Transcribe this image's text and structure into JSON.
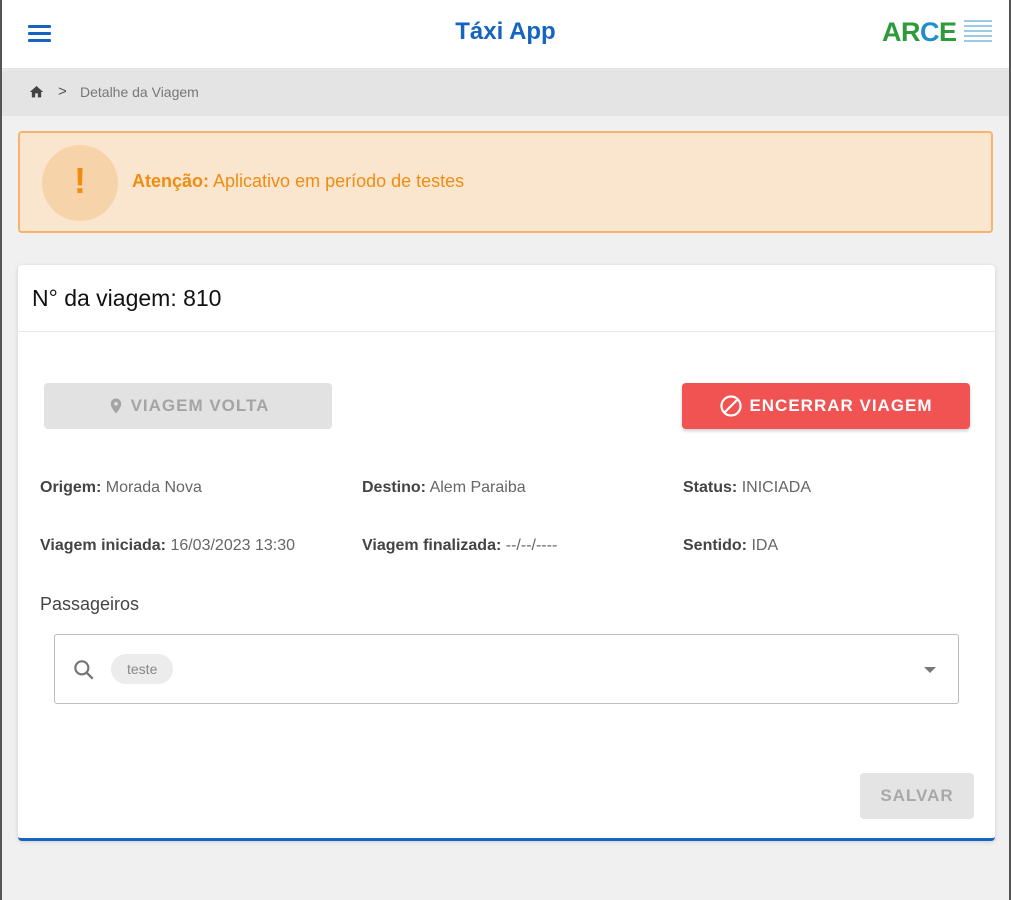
{
  "header": {
    "title": "Táxi App",
    "logo_text": "ARCE",
    "brand_color": "#1565c0"
  },
  "breadcrumb": {
    "current": "Detalhe da Viagem",
    "separator": ">"
  },
  "alert": {
    "icon": "!",
    "label": "Atenção:",
    "message": "Aplicativo em período de testes"
  },
  "trip": {
    "title": "N° da viagem: 810",
    "buttons": {
      "return_label": "VIAGEM VOLTA",
      "end_label": "ENCERRAR VIAGEM",
      "save_label": "SALVAR"
    },
    "fields": {
      "origin_label": "Origem:",
      "origin_value": "Morada Nova",
      "destination_label": "Destino:",
      "destination_value": "Alem Paraiba",
      "status_label": "Status:",
      "status_value": "INICIADA",
      "started_label": "Viagem iniciada:",
      "started_value": "16/03/2023 13:30",
      "finished_label": "Viagem finalizada:",
      "finished_value": "--/--/----",
      "direction_label": "Sentido:",
      "direction_value": "IDA"
    },
    "passengers": {
      "title": "Passageiros",
      "chips": [
        "teste"
      ]
    }
  },
  "colors": {
    "danger": "#f15252",
    "warning_text": "#f08c12",
    "warning_bg": "#fae6cf"
  }
}
